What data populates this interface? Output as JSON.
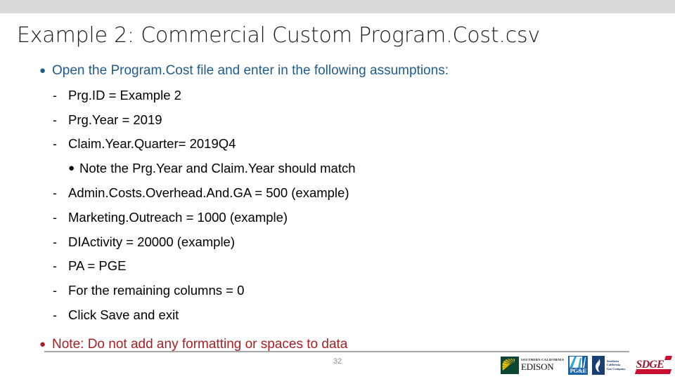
{
  "slide": {
    "title": "Example 2: Commercial Custom Program.Cost.csv",
    "page_number": "32",
    "colors": {
      "top_band": "#d9d9d9",
      "title": "#1a1a1a",
      "level1_blue": "#1f5c8b",
      "note_red": "#a62025",
      "rule_gray": "#a6a6a6",
      "page_number_gray": "#8c8c8c"
    }
  },
  "content": {
    "lines": [
      {
        "level": 1,
        "marker": "●",
        "text": "Open the Program.Cost file and enter in the following assumptions:"
      },
      {
        "level": 2,
        "marker": "-",
        "text": "Prg.ID = Example 2"
      },
      {
        "level": 2,
        "marker": "-",
        "text": "Prg.Year = 2019"
      },
      {
        "level": 2,
        "marker": "-",
        "text": "Claim.Year.Quarter= 2019Q4"
      },
      {
        "level": 3,
        "marker": "●",
        "text": "Note the Prg.Year and Claim.Year should match"
      },
      {
        "level": 2,
        "marker": "-",
        "text": "Admin.Costs.Overhead.And.GA = 500 (example)"
      },
      {
        "level": 2,
        "marker": "-",
        "text": "Marketing.Outreach = 1000 (example)"
      },
      {
        "level": 2,
        "marker": "-",
        "text": "DIActivity = 20000 (example)"
      },
      {
        "level": 2,
        "marker": "-",
        "text": "PA = PGE"
      },
      {
        "level": 2,
        "marker": "-",
        "text": "For the remaining columns = 0"
      },
      {
        "level": 2,
        "marker": "-",
        "text": "Click Save and exit"
      },
      {
        "level": 4,
        "marker": "●",
        "text": "Note: Do not add any formatting or spaces to data"
      }
    ]
  },
  "footer": {
    "logos": [
      {
        "name": "southern-california-edison",
        "line1": "SOUTHERN CALIFORNIA",
        "line2": "EDISON",
        "mark_color": "#0d4632",
        "sun_color": "#f2c200"
      },
      {
        "name": "pacific-gas-and-electric",
        "label": "PG&E",
        "box_color": "#1b63a8"
      },
      {
        "name": "southern-california-gas-company",
        "line1": "Southern",
        "line2": "California",
        "line3": "Gas Company",
        "box_color": "#1b3e72"
      },
      {
        "name": "san-diego-gas-and-electric",
        "label": "SDGE",
        "accent_color": "#c8102e"
      }
    ]
  }
}
